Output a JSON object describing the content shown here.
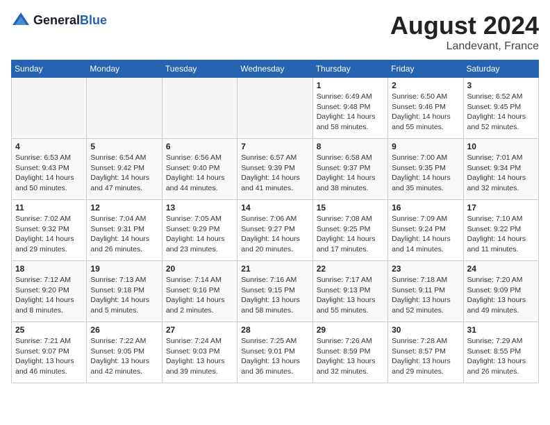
{
  "header": {
    "logo_line1": "General",
    "logo_line2": "Blue",
    "month": "August 2024",
    "location": "Landevant, France"
  },
  "weekdays": [
    "Sunday",
    "Monday",
    "Tuesday",
    "Wednesday",
    "Thursday",
    "Friday",
    "Saturday"
  ],
  "weeks": [
    [
      {
        "day": "",
        "info": ""
      },
      {
        "day": "",
        "info": ""
      },
      {
        "day": "",
        "info": ""
      },
      {
        "day": "",
        "info": ""
      },
      {
        "day": "1",
        "info": "Sunrise: 6:49 AM\nSunset: 9:48 PM\nDaylight: 14 hours\nand 58 minutes."
      },
      {
        "day": "2",
        "info": "Sunrise: 6:50 AM\nSunset: 9:46 PM\nDaylight: 14 hours\nand 55 minutes."
      },
      {
        "day": "3",
        "info": "Sunrise: 6:52 AM\nSunset: 9:45 PM\nDaylight: 14 hours\nand 52 minutes."
      }
    ],
    [
      {
        "day": "4",
        "info": "Sunrise: 6:53 AM\nSunset: 9:43 PM\nDaylight: 14 hours\nand 50 minutes."
      },
      {
        "day": "5",
        "info": "Sunrise: 6:54 AM\nSunset: 9:42 PM\nDaylight: 14 hours\nand 47 minutes."
      },
      {
        "day": "6",
        "info": "Sunrise: 6:56 AM\nSunset: 9:40 PM\nDaylight: 14 hours\nand 44 minutes."
      },
      {
        "day": "7",
        "info": "Sunrise: 6:57 AM\nSunset: 9:39 PM\nDaylight: 14 hours\nand 41 minutes."
      },
      {
        "day": "8",
        "info": "Sunrise: 6:58 AM\nSunset: 9:37 PM\nDaylight: 14 hours\nand 38 minutes."
      },
      {
        "day": "9",
        "info": "Sunrise: 7:00 AM\nSunset: 9:35 PM\nDaylight: 14 hours\nand 35 minutes."
      },
      {
        "day": "10",
        "info": "Sunrise: 7:01 AM\nSunset: 9:34 PM\nDaylight: 14 hours\nand 32 minutes."
      }
    ],
    [
      {
        "day": "11",
        "info": "Sunrise: 7:02 AM\nSunset: 9:32 PM\nDaylight: 14 hours\nand 29 minutes."
      },
      {
        "day": "12",
        "info": "Sunrise: 7:04 AM\nSunset: 9:31 PM\nDaylight: 14 hours\nand 26 minutes."
      },
      {
        "day": "13",
        "info": "Sunrise: 7:05 AM\nSunset: 9:29 PM\nDaylight: 14 hours\nand 23 minutes."
      },
      {
        "day": "14",
        "info": "Sunrise: 7:06 AM\nSunset: 9:27 PM\nDaylight: 14 hours\nand 20 minutes."
      },
      {
        "day": "15",
        "info": "Sunrise: 7:08 AM\nSunset: 9:25 PM\nDaylight: 14 hours\nand 17 minutes."
      },
      {
        "day": "16",
        "info": "Sunrise: 7:09 AM\nSunset: 9:24 PM\nDaylight: 14 hours\nand 14 minutes."
      },
      {
        "day": "17",
        "info": "Sunrise: 7:10 AM\nSunset: 9:22 PM\nDaylight: 14 hours\nand 11 minutes."
      }
    ],
    [
      {
        "day": "18",
        "info": "Sunrise: 7:12 AM\nSunset: 9:20 PM\nDaylight: 14 hours\nand 8 minutes."
      },
      {
        "day": "19",
        "info": "Sunrise: 7:13 AM\nSunset: 9:18 PM\nDaylight: 14 hours\nand 5 minutes."
      },
      {
        "day": "20",
        "info": "Sunrise: 7:14 AM\nSunset: 9:16 PM\nDaylight: 14 hours\nand 2 minutes."
      },
      {
        "day": "21",
        "info": "Sunrise: 7:16 AM\nSunset: 9:15 PM\nDaylight: 13 hours\nand 58 minutes."
      },
      {
        "day": "22",
        "info": "Sunrise: 7:17 AM\nSunset: 9:13 PM\nDaylight: 13 hours\nand 55 minutes."
      },
      {
        "day": "23",
        "info": "Sunrise: 7:18 AM\nSunset: 9:11 PM\nDaylight: 13 hours\nand 52 minutes."
      },
      {
        "day": "24",
        "info": "Sunrise: 7:20 AM\nSunset: 9:09 PM\nDaylight: 13 hours\nand 49 minutes."
      }
    ],
    [
      {
        "day": "25",
        "info": "Sunrise: 7:21 AM\nSunset: 9:07 PM\nDaylight: 13 hours\nand 46 minutes."
      },
      {
        "day": "26",
        "info": "Sunrise: 7:22 AM\nSunset: 9:05 PM\nDaylight: 13 hours\nand 42 minutes."
      },
      {
        "day": "27",
        "info": "Sunrise: 7:24 AM\nSunset: 9:03 PM\nDaylight: 13 hours\nand 39 minutes."
      },
      {
        "day": "28",
        "info": "Sunrise: 7:25 AM\nSunset: 9:01 PM\nDaylight: 13 hours\nand 36 minutes."
      },
      {
        "day": "29",
        "info": "Sunrise: 7:26 AM\nSunset: 8:59 PM\nDaylight: 13 hours\nand 32 minutes."
      },
      {
        "day": "30",
        "info": "Sunrise: 7:28 AM\nSunset: 8:57 PM\nDaylight: 13 hours\nand 29 minutes."
      },
      {
        "day": "31",
        "info": "Sunrise: 7:29 AM\nSunset: 8:55 PM\nDaylight: 13 hours\nand 26 minutes."
      }
    ]
  ]
}
